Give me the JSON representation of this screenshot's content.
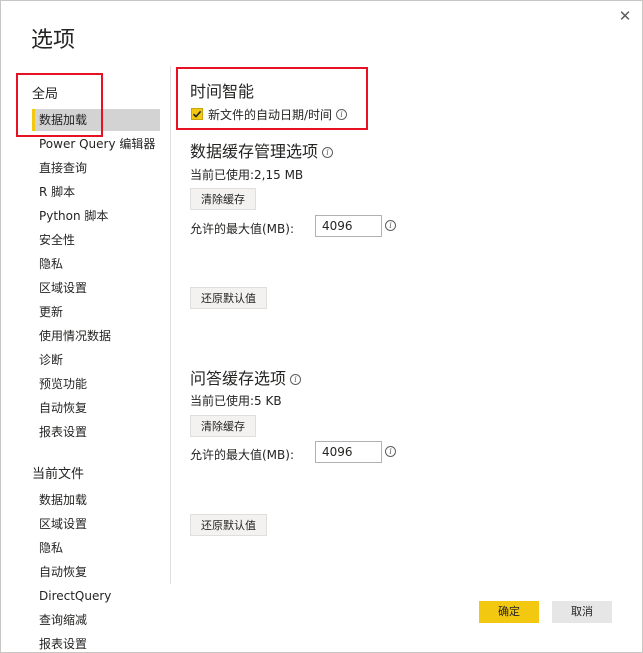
{
  "dialog": {
    "title": "选项",
    "close_glyph": "✕"
  },
  "sidebar": {
    "global_header": "全局",
    "global_items": [
      {
        "label": "数据加载",
        "selected": true
      },
      {
        "label": "Power Query 编辑器"
      },
      {
        "label": "直接查询"
      },
      {
        "label": "R 脚本"
      },
      {
        "label": "Python 脚本"
      },
      {
        "label": "安全性"
      },
      {
        "label": "隐私"
      },
      {
        "label": "区域设置"
      },
      {
        "label": "更新"
      },
      {
        "label": "使用情况数据"
      },
      {
        "label": "诊断"
      },
      {
        "label": "预览功能"
      },
      {
        "label": "自动恢复"
      },
      {
        "label": "报表设置"
      }
    ],
    "file_header": "当前文件",
    "file_items": [
      {
        "label": "数据加载"
      },
      {
        "label": "区域设置"
      },
      {
        "label": "隐私"
      },
      {
        "label": "自动恢复"
      },
      {
        "label": "DirectQuery"
      },
      {
        "label": "查询缩减"
      },
      {
        "label": "报表设置"
      }
    ]
  },
  "time_intelligence": {
    "heading": "时间智能",
    "checkbox_label": "新文件的自动日期/时间",
    "checked": true
  },
  "data_cache": {
    "heading": "数据缓存管理选项",
    "current_usage": "当前已使用:2,15 MB",
    "clear_label": "清除缓存",
    "max_label": "允许的最大值(MB):",
    "max_value": "4096",
    "restore_label": "还原默认值"
  },
  "qa_cache": {
    "heading": "问答缓存选项",
    "current_usage": "当前已使用:5 KB",
    "clear_label": "清除缓存",
    "max_label": "允许的最大值(MB):",
    "max_value": "4096",
    "restore_label": "还原默认值"
  },
  "footer": {
    "ok_label": "确定",
    "cancel_label": "取消"
  },
  "colors": {
    "accent": "#f2c811",
    "highlight_box": "#e81123",
    "selected_bg": "#d3d3d3"
  },
  "icons": {
    "info": "info-icon",
    "check": "checkmark-icon",
    "close": "close-icon"
  }
}
